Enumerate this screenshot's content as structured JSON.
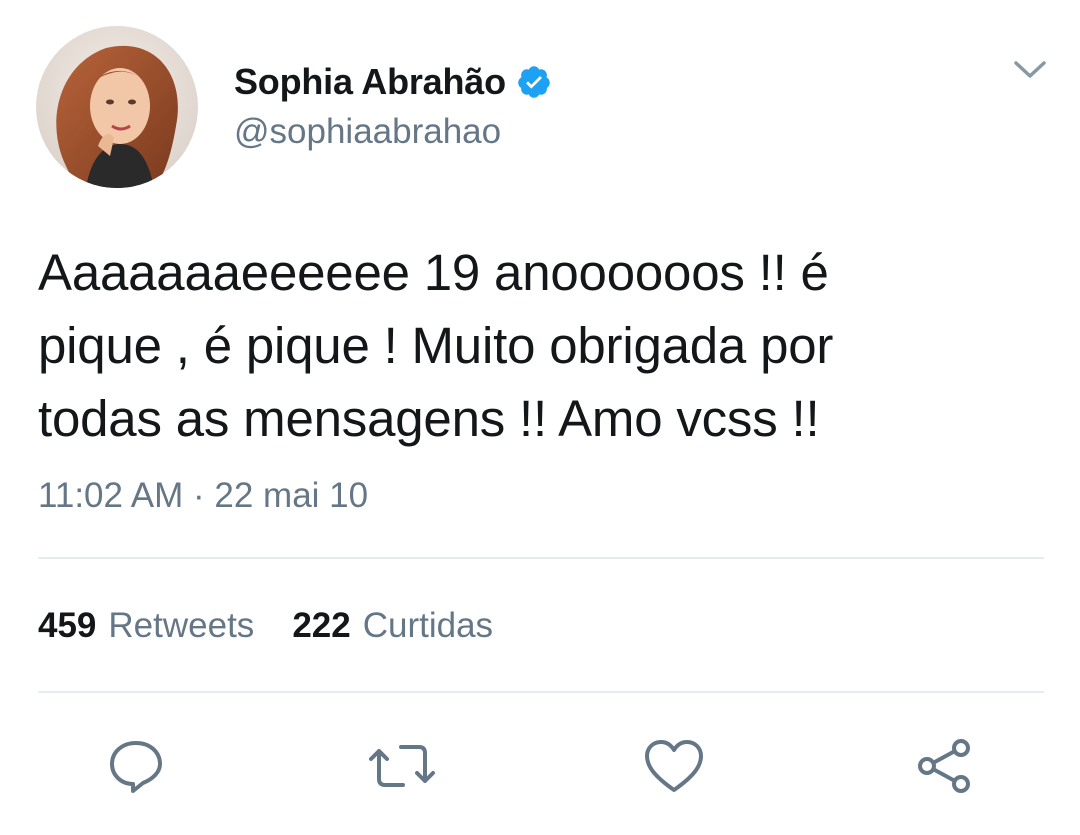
{
  "author": {
    "display_name": "Sophia Abrahão",
    "handle": "@sophiaabrahao",
    "verified": true,
    "avatar_icon": "profile-photo"
  },
  "menu": {
    "caret_icon": "chevron-down-icon"
  },
  "tweet": {
    "text": "Aaaaaaaeeeeee 19 anoooooos !! é\npique , é pique ! Muito obrigada por\ntodas as mensagens !! Amo vcss !!",
    "timestamp": "11:02 AM · 22 mai 10"
  },
  "stats": {
    "retweets_count": "459",
    "retweets_label": "Retweets",
    "likes_count": "222",
    "likes_label": "Curtidas"
  },
  "actions": {
    "reply_icon": "reply-icon",
    "retweet_icon": "retweet-icon",
    "like_icon": "heart-icon",
    "share_icon": "share-icon"
  },
  "colors": {
    "text_primary": "#14171a",
    "text_secondary": "#657786",
    "verified_blue": "#1da1f2",
    "divider": "#e6ecf0",
    "icon_gray": "#657786"
  }
}
